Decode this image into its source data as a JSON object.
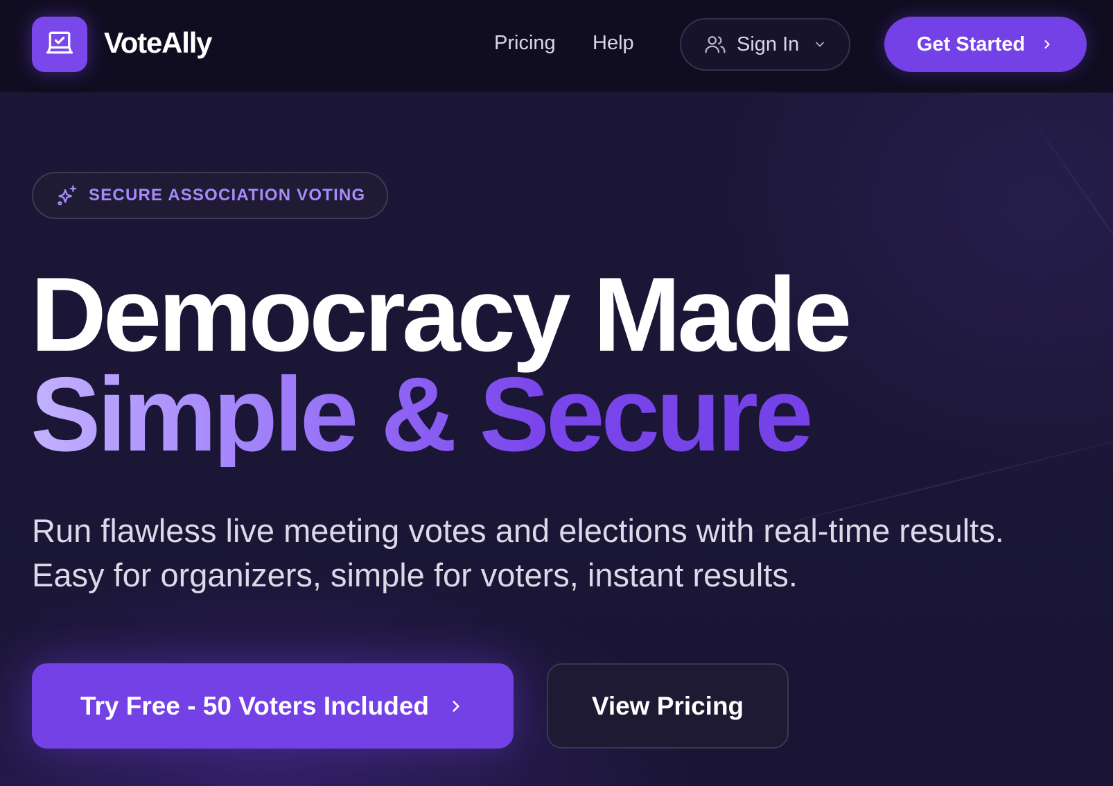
{
  "colors": {
    "accent": "#7441e6",
    "badge_text": "#a78bfa",
    "background": "#1b1636",
    "nav_background": "#100d20"
  },
  "nav": {
    "brand": "VoteAlly",
    "logo_icon": "laptop-check-icon",
    "links": [
      "Pricing",
      "Help"
    ],
    "sign_in": {
      "label": "Sign In",
      "icon": "users-icon",
      "chevron": "chevron-down-icon"
    },
    "get_started": {
      "label": "Get Started",
      "icon": "chevron-right-icon"
    }
  },
  "hero": {
    "badge": {
      "label": "SECURE ASSOCIATION VOTING",
      "icon": "sparkles-icon"
    },
    "headline_line1": "Democracy Made",
    "headline_line2": "Simple & Secure",
    "subheadline": "Run flawless live meeting votes and elections with real-time results. Easy for organizers, simple for voters, instant results.",
    "primary_cta": {
      "label": "Try Free - 50 Voters Included",
      "icon": "chevron-right-icon"
    },
    "secondary_cta": {
      "label": "View Pricing"
    }
  }
}
